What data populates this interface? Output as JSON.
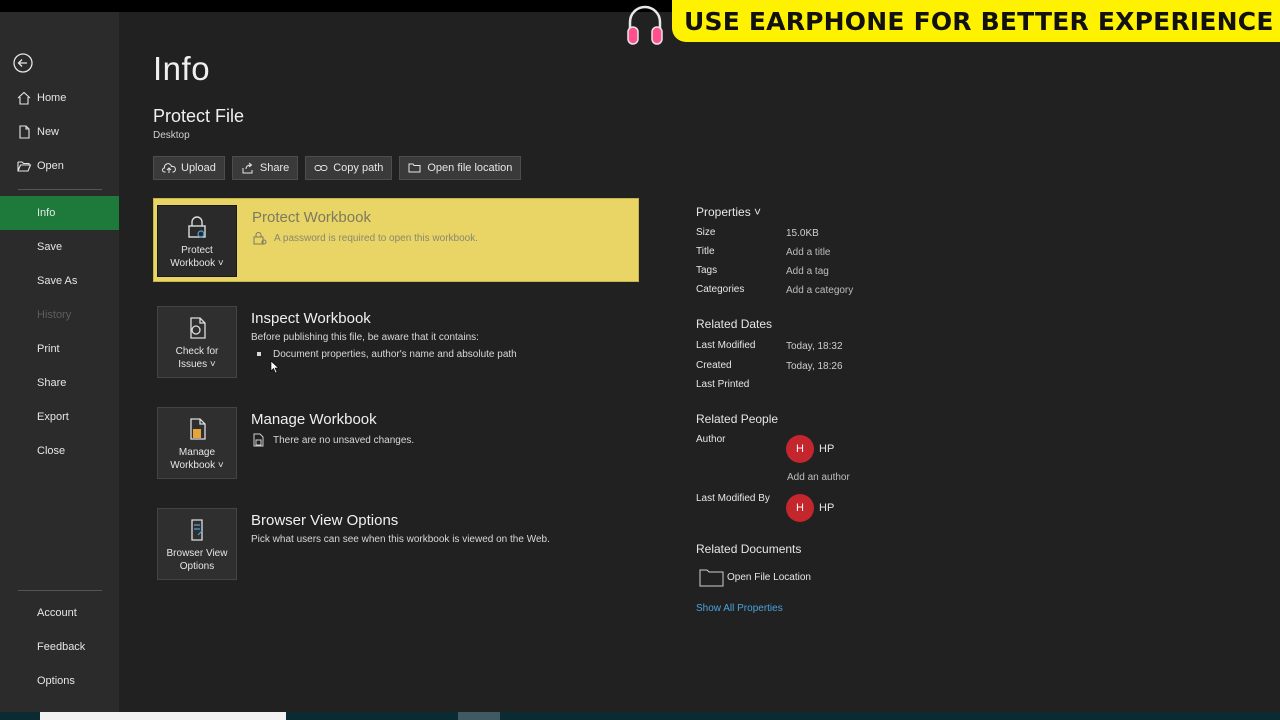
{
  "sidebar": {
    "items": [
      {
        "label": "Home",
        "icon": "home-icon"
      },
      {
        "label": "New",
        "icon": "new-file-icon"
      },
      {
        "label": "Open",
        "icon": "folder-open-icon"
      },
      {
        "label": "Info",
        "active": true
      },
      {
        "label": "Save"
      },
      {
        "label": "Save As"
      },
      {
        "label": "History",
        "disabled": true
      },
      {
        "label": "Print"
      },
      {
        "label": "Share"
      },
      {
        "label": "Export"
      },
      {
        "label": "Close"
      }
    ],
    "footer": [
      {
        "label": "Account"
      },
      {
        "label": "Feedback"
      },
      {
        "label": "Options"
      }
    ]
  },
  "main": {
    "title": "Info",
    "file_name": "Protect File",
    "file_location": "Desktop",
    "toolbar": [
      {
        "label": "Upload",
        "icon": "cloud-upload-icon"
      },
      {
        "label": "Share",
        "icon": "share-icon"
      },
      {
        "label": "Copy path",
        "icon": "link-icon"
      },
      {
        "label": "Open file location",
        "icon": "folder-icon"
      }
    ],
    "cards": [
      {
        "button_label_1": "Protect",
        "button_label_2": "Workbook ˅",
        "title": "Protect Workbook",
        "description": "A password is required to open this workbook."
      },
      {
        "button_label_1": "Check for",
        "button_label_2": "Issues ˅",
        "title": "Inspect Workbook",
        "description": "Before publishing this file, be aware that it contains:",
        "bullet": "Document properties, author's name and absolute path"
      },
      {
        "button_label_1": "Manage",
        "button_label_2": "Workbook ˅",
        "title": "Manage Workbook",
        "description": "There are no unsaved changes."
      },
      {
        "button_label_1": "Browser View",
        "button_label_2": "Options",
        "title": "Browser View Options",
        "description": "Pick what users can see when this workbook is viewed on the Web."
      }
    ]
  },
  "properties": {
    "header": "Properties ˅",
    "rows": [
      {
        "key": "Size",
        "value": "15.0KB"
      },
      {
        "key": "Title",
        "value": "Add a title"
      },
      {
        "key": "Tags",
        "value": "Add a tag"
      },
      {
        "key": "Categories",
        "value": "Add a category"
      }
    ],
    "related_dates_header": "Related Dates",
    "dates": [
      {
        "key": "Last Modified",
        "value": "Today, 18:32"
      },
      {
        "key": "Created",
        "value": "Today, 18:26"
      },
      {
        "key": "Last Printed",
        "value": ""
      }
    ],
    "related_people_header": "Related People",
    "author_label": "Author",
    "author_initial": "H",
    "author_name": "HP",
    "add_author": "Add an author",
    "last_modified_by_label": "Last Modified By",
    "modifier_initial": "H",
    "modifier_name": "HP",
    "related_documents_header": "Related Documents",
    "open_file_location": "Open File Location",
    "show_all": "Show All Properties"
  },
  "banner": {
    "text": "USE EARPHONE FOR BETTER EXPERIENCE"
  },
  "colors": {
    "accent_green": "#1e7a3a",
    "highlight_yellow": "#e8d565",
    "banner_yellow": "#fef200",
    "avatar_red": "#c4262e",
    "link_blue": "#4aa3df"
  }
}
